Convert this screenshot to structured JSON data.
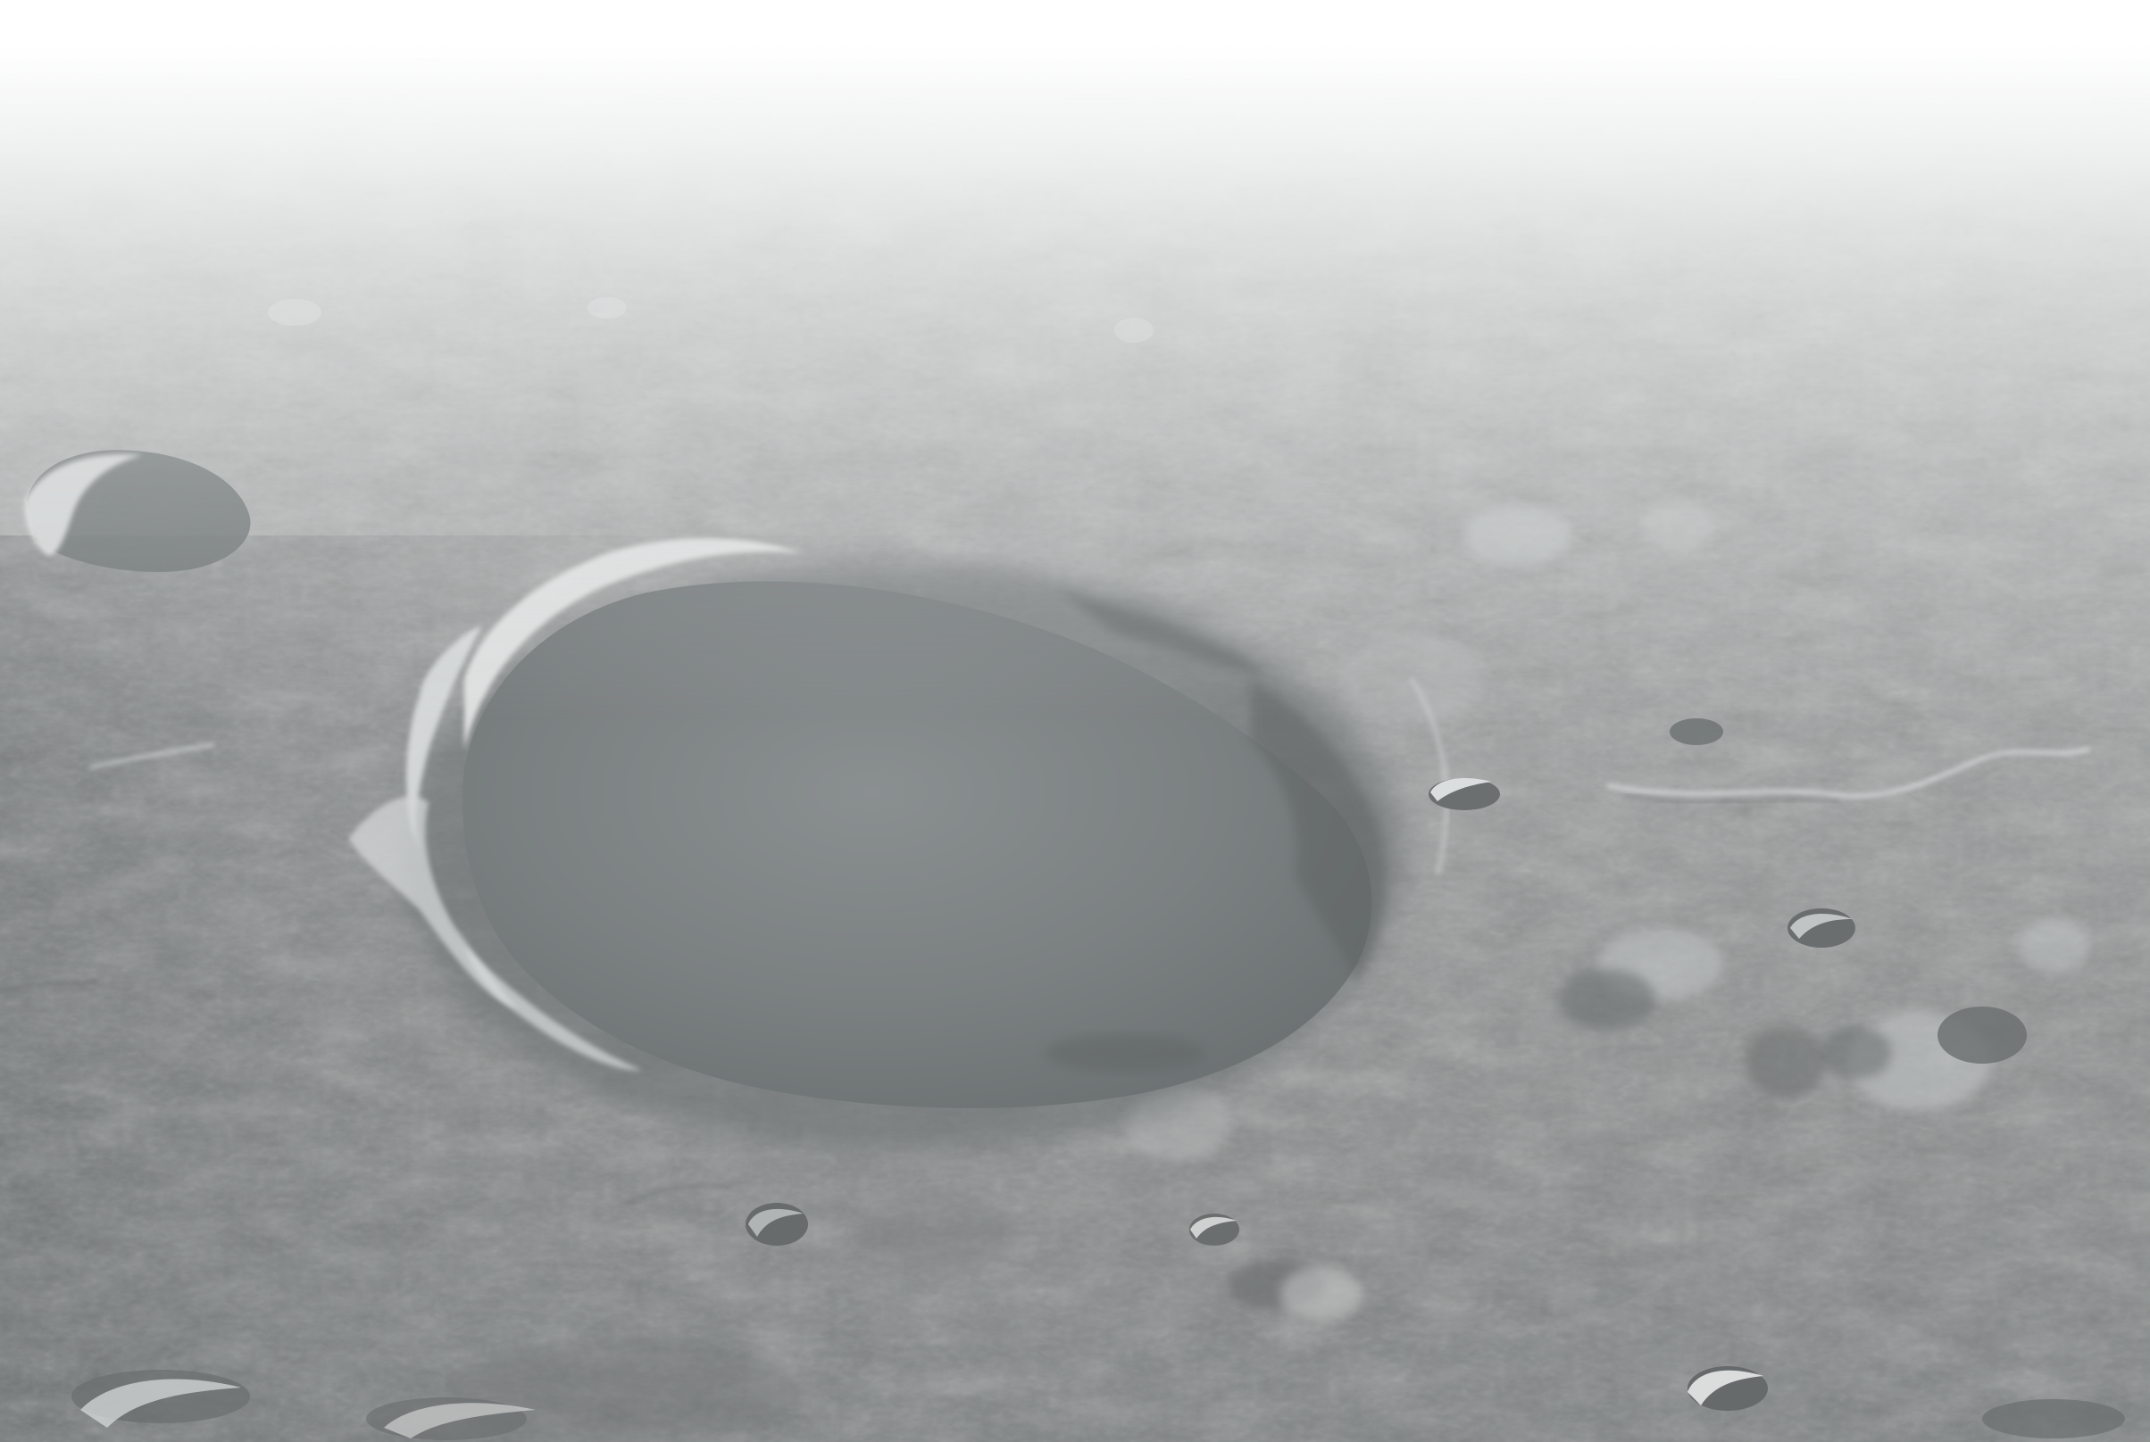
{
  "image": {
    "subject": "",
    "palette": {
      "haze": "#ffffff",
      "plain_light": "#b4b6b6",
      "plain_mid": "#8f9292",
      "plain_dark": "#6e7272",
      "crater_floor": "#767b7c",
      "crater_floor_dark": "#6b7071",
      "rim_highlight": "#e6e8e8",
      "shadow": "#5e6263"
    }
  }
}
